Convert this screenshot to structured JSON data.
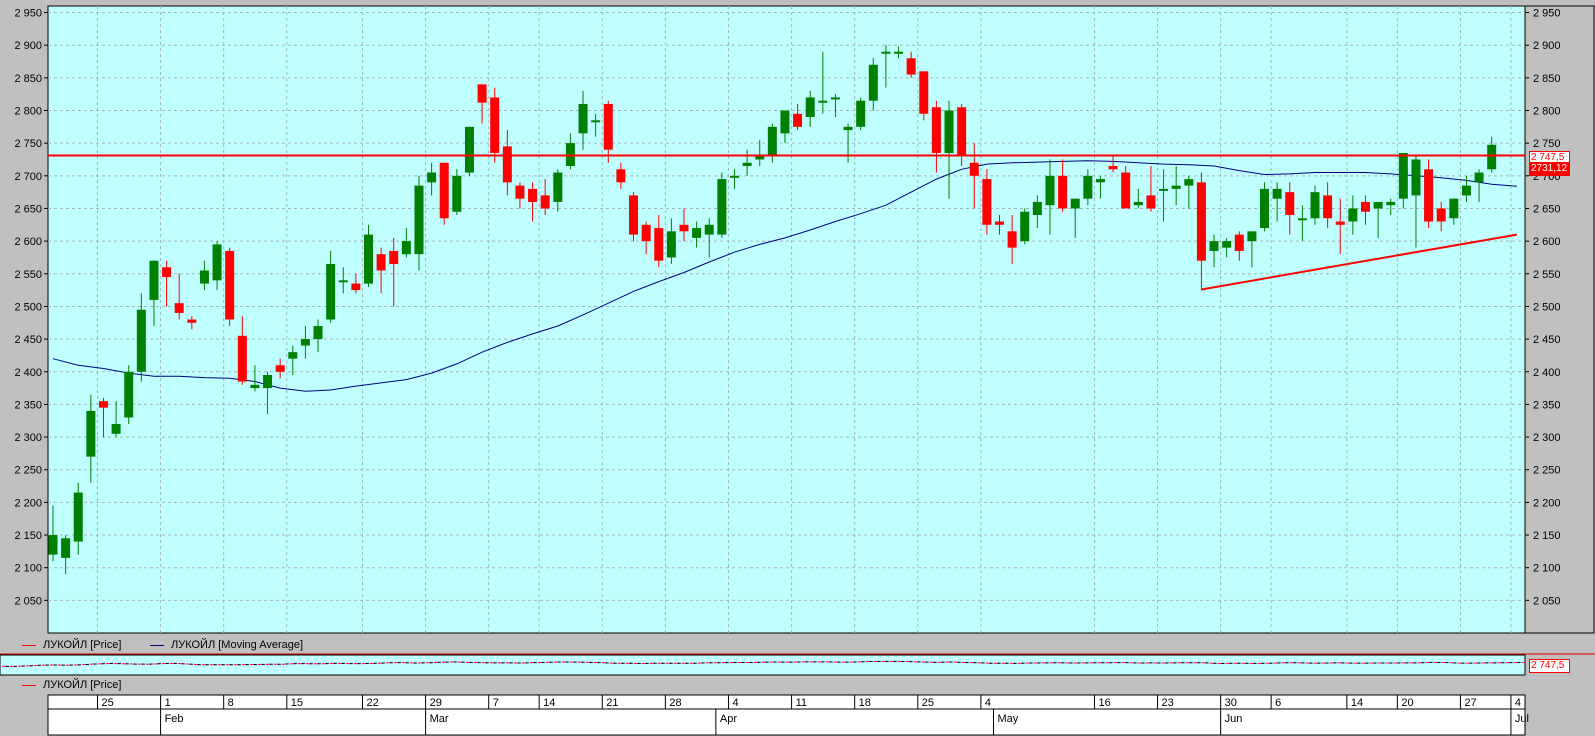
{
  "legend": {
    "price_label": "ЛУКОЙЛ [Price]",
    "ma_label": "ЛУКОЙЛ [Moving Average]"
  },
  "navigator": {
    "legend_label": "ЛУКОЙЛ [Price]"
  },
  "colors": {
    "background": "#c0ffff",
    "up": "#008000",
    "down": "#ff0000",
    "moving_average": "#000080",
    "hline": "#ff0000",
    "trendline": "#ff0000",
    "grid": "#a0b8b8"
  },
  "chart_data": {
    "type": "candlestick",
    "title": "",
    "y_range": [
      2000,
      2960
    ],
    "y_ticks": [
      2050,
      2100,
      2150,
      2200,
      2250,
      2300,
      2350,
      2400,
      2450,
      2500,
      2550,
      2600,
      2650,
      2700,
      2750,
      2800,
      2850,
      2900,
      2950
    ],
    "y_tick_labels": [
      "2 050",
      "2 100",
      "2 150",
      "2 200",
      "2 250",
      "2 300",
      "2 350",
      "2 400",
      "2 450",
      "2 500",
      "2 550",
      "2 600",
      "2 650",
      "2 700",
      "2 750",
      "2 800",
      "2 850",
      "2 900",
      "2 950"
    ],
    "x_day_labels": [
      "25",
      "1",
      "8",
      "15",
      "22",
      "29",
      "7",
      "14",
      "21",
      "28",
      "4",
      "11",
      "18",
      "25",
      "4",
      "16",
      "23",
      "30",
      "6",
      "14",
      "20",
      "27",
      "4"
    ],
    "x_month_labels": [
      "Feb",
      "Mar",
      "Apr",
      "May",
      "Jun",
      "Jul"
    ],
    "last_price_label": "2 747,5",
    "hline_label": "2731,12",
    "hline_value": 2731.12,
    "navigator_price_label": "2 747,5",
    "candles": [
      {
        "o": 2120,
        "h": 2195,
        "l": 2110,
        "c": 2150
      },
      {
        "o": 2115,
        "h": 2150,
        "l": 2090,
        "c": 2145
      },
      {
        "o": 2140,
        "h": 2230,
        "l": 2120,
        "c": 2215
      },
      {
        "o": 2270,
        "h": 2365,
        "l": 2230,
        "c": 2340
      },
      {
        "o": 2355,
        "h": 2360,
        "l": 2300,
        "c": 2345
      },
      {
        "o": 2305,
        "h": 2355,
        "l": 2300,
        "c": 2320
      },
      {
        "o": 2330,
        "h": 2410,
        "l": 2320,
        "c": 2400
      },
      {
        "o": 2400,
        "h": 2520,
        "l": 2385,
        "c": 2495
      },
      {
        "o": 2510,
        "h": 2570,
        "l": 2470,
        "c": 2570
      },
      {
        "o": 2560,
        "h": 2570,
        "l": 2500,
        "c": 2545
      },
      {
        "o": 2505,
        "h": 2550,
        "l": 2480,
        "c": 2490
      },
      {
        "o": 2480,
        "h": 2485,
        "l": 2465,
        "c": 2475
      },
      {
        "o": 2535,
        "h": 2570,
        "l": 2525,
        "c": 2555
      },
      {
        "o": 2540,
        "h": 2600,
        "l": 2525,
        "c": 2595
      },
      {
        "o": 2585,
        "h": 2590,
        "l": 2470,
        "c": 2480
      },
      {
        "o": 2455,
        "h": 2485,
        "l": 2380,
        "c": 2385
      },
      {
        "o": 2375,
        "h": 2410,
        "l": 2370,
        "c": 2380
      },
      {
        "o": 2375,
        "h": 2400,
        "l": 2335,
        "c": 2395
      },
      {
        "o": 2410,
        "h": 2420,
        "l": 2390,
        "c": 2400
      },
      {
        "o": 2420,
        "h": 2440,
        "l": 2395,
        "c": 2430
      },
      {
        "o": 2440,
        "h": 2470,
        "l": 2420,
        "c": 2450
      },
      {
        "o": 2450,
        "h": 2480,
        "l": 2430,
        "c": 2470
      },
      {
        "o": 2480,
        "h": 2585,
        "l": 2475,
        "c": 2565
      },
      {
        "o": 2540,
        "h": 2560,
        "l": 2520,
        "c": 2540
      },
      {
        "o": 2535,
        "h": 2550,
        "l": 2520,
        "c": 2525
      },
      {
        "o": 2535,
        "h": 2625,
        "l": 2530,
        "c": 2610
      },
      {
        "o": 2580,
        "h": 2590,
        "l": 2520,
        "c": 2555
      },
      {
        "o": 2585,
        "h": 2605,
        "l": 2500,
        "c": 2565
      },
      {
        "o": 2580,
        "h": 2620,
        "l": 2575,
        "c": 2600
      },
      {
        "o": 2580,
        "h": 2700,
        "l": 2555,
        "c": 2685
      },
      {
        "o": 2690,
        "h": 2720,
        "l": 2670,
        "c": 2705
      },
      {
        "o": 2720,
        "h": 2720,
        "l": 2625,
        "c": 2635
      },
      {
        "o": 2645,
        "h": 2710,
        "l": 2640,
        "c": 2700
      },
      {
        "o": 2705,
        "h": 2775,
        "l": 2700,
        "c": 2775
      },
      {
        "o": 2840,
        "h": 2840,
        "l": 2780,
        "c": 2812
      },
      {
        "o": 2820,
        "h": 2835,
        "l": 2720,
        "c": 2735
      },
      {
        "o": 2745,
        "h": 2770,
        "l": 2670,
        "c": 2690
      },
      {
        "o": 2685,
        "h": 2690,
        "l": 2650,
        "c": 2665
      },
      {
        "o": 2680,
        "h": 2690,
        "l": 2630,
        "c": 2660
      },
      {
        "o": 2670,
        "h": 2695,
        "l": 2640,
        "c": 2650
      },
      {
        "o": 2660,
        "h": 2710,
        "l": 2645,
        "c": 2705
      },
      {
        "o": 2715,
        "h": 2765,
        "l": 2710,
        "c": 2750
      },
      {
        "o": 2765,
        "h": 2830,
        "l": 2740,
        "c": 2810
      },
      {
        "o": 2785,
        "h": 2795,
        "l": 2760,
        "c": 2785
      },
      {
        "o": 2810,
        "h": 2815,
        "l": 2720,
        "c": 2740
      },
      {
        "o": 2710,
        "h": 2720,
        "l": 2680,
        "c": 2690
      },
      {
        "o": 2670,
        "h": 2675,
        "l": 2600,
        "c": 2610
      },
      {
        "o": 2625,
        "h": 2630,
        "l": 2580,
        "c": 2600
      },
      {
        "o": 2620,
        "h": 2640,
        "l": 2560,
        "c": 2570
      },
      {
        "o": 2575,
        "h": 2635,
        "l": 2565,
        "c": 2615
      },
      {
        "o": 2625,
        "h": 2650,
        "l": 2600,
        "c": 2615
      },
      {
        "o": 2605,
        "h": 2630,
        "l": 2590,
        "c": 2620
      },
      {
        "o": 2610,
        "h": 2635,
        "l": 2575,
        "c": 2625
      },
      {
        "o": 2610,
        "h": 2705,
        "l": 2605,
        "c": 2695
      },
      {
        "o": 2700,
        "h": 2710,
        "l": 2680,
        "c": 2700
      },
      {
        "o": 2715,
        "h": 2740,
        "l": 2700,
        "c": 2720
      },
      {
        "o": 2725,
        "h": 2755,
        "l": 2715,
        "c": 2730
      },
      {
        "o": 2730,
        "h": 2780,
        "l": 2720,
        "c": 2775
      },
      {
        "o": 2765,
        "h": 2800,
        "l": 2750,
        "c": 2800
      },
      {
        "o": 2795,
        "h": 2810,
        "l": 2770,
        "c": 2775
      },
      {
        "o": 2790,
        "h": 2830,
        "l": 2775,
        "c": 2820
      },
      {
        "o": 2815,
        "h": 2890,
        "l": 2795,
        "c": 2815
      },
      {
        "o": 2820,
        "h": 2825,
        "l": 2790,
        "c": 2820
      },
      {
        "o": 2770,
        "h": 2780,
        "l": 2720,
        "c": 2775
      },
      {
        "o": 2775,
        "h": 2820,
        "l": 2770,
        "c": 2815
      },
      {
        "o": 2815,
        "h": 2880,
        "l": 2800,
        "c": 2870
      },
      {
        "o": 2890,
        "h": 2900,
        "l": 2835,
        "c": 2890
      },
      {
        "o": 2888,
        "h": 2898,
        "l": 2880,
        "c": 2890
      },
      {
        "o": 2880,
        "h": 2890,
        "l": 2850,
        "c": 2855
      },
      {
        "o": 2860,
        "h": 2860,
        "l": 2785,
        "c": 2795
      },
      {
        "o": 2805,
        "h": 2815,
        "l": 2705,
        "c": 2735
      },
      {
        "o": 2735,
        "h": 2815,
        "l": 2665,
        "c": 2800
      },
      {
        "o": 2805,
        "h": 2810,
        "l": 2715,
        "c": 2730
      },
      {
        "o": 2720,
        "h": 2750,
        "l": 2650,
        "c": 2700
      },
      {
        "o": 2695,
        "h": 2710,
        "l": 2610,
        "c": 2625
      },
      {
        "o": 2630,
        "h": 2640,
        "l": 2610,
        "c": 2625
      },
      {
        "o": 2615,
        "h": 2640,
        "l": 2565,
        "c": 2590
      },
      {
        "o": 2600,
        "h": 2650,
        "l": 2595,
        "c": 2645
      },
      {
        "o": 2640,
        "h": 2670,
        "l": 2620,
        "c": 2660
      },
      {
        "o": 2655,
        "h": 2725,
        "l": 2610,
        "c": 2700
      },
      {
        "o": 2700,
        "h": 2725,
        "l": 2645,
        "c": 2650
      },
      {
        "o": 2650,
        "h": 2660,
        "l": 2605,
        "c": 2665
      },
      {
        "o": 2665,
        "h": 2710,
        "l": 2655,
        "c": 2700
      },
      {
        "o": 2690,
        "h": 2700,
        "l": 2665,
        "c": 2695
      },
      {
        "o": 2715,
        "h": 2730,
        "l": 2705,
        "c": 2710
      },
      {
        "o": 2705,
        "h": 2715,
        "l": 2650,
        "c": 2650
      },
      {
        "o": 2655,
        "h": 2680,
        "l": 2650,
        "c": 2660
      },
      {
        "o": 2670,
        "h": 2715,
        "l": 2645,
        "c": 2650
      },
      {
        "o": 2680,
        "h": 2710,
        "l": 2630,
        "c": 2680
      },
      {
        "o": 2680,
        "h": 2715,
        "l": 2655,
        "c": 2685
      },
      {
        "o": 2685,
        "h": 2700,
        "l": 2650,
        "c": 2695
      },
      {
        "o": 2690,
        "h": 2705,
        "l": 2525,
        "c": 2570
      },
      {
        "o": 2585,
        "h": 2610,
        "l": 2560,
        "c": 2600
      },
      {
        "o": 2590,
        "h": 2605,
        "l": 2575,
        "c": 2600
      },
      {
        "o": 2610,
        "h": 2615,
        "l": 2570,
        "c": 2585
      },
      {
        "o": 2600,
        "h": 2610,
        "l": 2560,
        "c": 2615
      },
      {
        "o": 2620,
        "h": 2690,
        "l": 2615,
        "c": 2680
      },
      {
        "o": 2665,
        "h": 2690,
        "l": 2630,
        "c": 2680
      },
      {
        "o": 2675,
        "h": 2690,
        "l": 2610,
        "c": 2640
      },
      {
        "o": 2635,
        "h": 2655,
        "l": 2600,
        "c": 2635
      },
      {
        "o": 2635,
        "h": 2685,
        "l": 2625,
        "c": 2675
      },
      {
        "o": 2670,
        "h": 2690,
        "l": 2620,
        "c": 2635
      },
      {
        "o": 2630,
        "h": 2665,
        "l": 2580,
        "c": 2625
      },
      {
        "o": 2630,
        "h": 2670,
        "l": 2610,
        "c": 2650
      },
      {
        "o": 2660,
        "h": 2670,
        "l": 2625,
        "c": 2645
      },
      {
        "o": 2650,
        "h": 2660,
        "l": 2605,
        "c": 2660
      },
      {
        "o": 2655,
        "h": 2665,
        "l": 2640,
        "c": 2660
      },
      {
        "o": 2665,
        "h": 2735,
        "l": 2650,
        "c": 2735
      },
      {
        "o": 2670,
        "h": 2730,
        "l": 2590,
        "c": 2725
      },
      {
        "o": 2710,
        "h": 2725,
        "l": 2620,
        "c": 2630
      },
      {
        "o": 2650,
        "h": 2660,
        "l": 2615,
        "c": 2630
      },
      {
        "o": 2635,
        "h": 2665,
        "l": 2625,
        "c": 2665
      },
      {
        "o": 2670,
        "h": 2700,
        "l": 2660,
        "c": 2685
      },
      {
        "o": 2690,
        "h": 2710,
        "l": 2660,
        "c": 2705
      },
      {
        "o": 2710,
        "h": 2760,
        "l": 2705,
        "c": 2747.5
      }
    ],
    "moving_average": [
      {
        "i": 0,
        "v": 2420
      },
      {
        "i": 2,
        "v": 2410
      },
      {
        "i": 4,
        "v": 2405
      },
      {
        "i": 6,
        "v": 2398
      },
      {
        "i": 8,
        "v": 2393
      },
      {
        "i": 10,
        "v": 2393
      },
      {
        "i": 12,
        "v": 2391
      },
      {
        "i": 14,
        "v": 2390
      },
      {
        "i": 16,
        "v": 2385
      },
      {
        "i": 18,
        "v": 2375
      },
      {
        "i": 20,
        "v": 2370
      },
      {
        "i": 22,
        "v": 2372
      },
      {
        "i": 24,
        "v": 2378
      },
      {
        "i": 26,
        "v": 2383
      },
      {
        "i": 28,
        "v": 2388
      },
      {
        "i": 30,
        "v": 2398
      },
      {
        "i": 32,
        "v": 2412
      },
      {
        "i": 34,
        "v": 2430
      },
      {
        "i": 36,
        "v": 2445
      },
      {
        "i": 38,
        "v": 2458
      },
      {
        "i": 40,
        "v": 2470
      },
      {
        "i": 42,
        "v": 2487
      },
      {
        "i": 44,
        "v": 2505
      },
      {
        "i": 46,
        "v": 2523
      },
      {
        "i": 48,
        "v": 2538
      },
      {
        "i": 50,
        "v": 2552
      },
      {
        "i": 52,
        "v": 2568
      },
      {
        "i": 54,
        "v": 2583
      },
      {
        "i": 56,
        "v": 2595
      },
      {
        "i": 58,
        "v": 2605
      },
      {
        "i": 60,
        "v": 2617
      },
      {
        "i": 62,
        "v": 2630
      },
      {
        "i": 64,
        "v": 2642
      },
      {
        "i": 66,
        "v": 2655
      },
      {
        "i": 68,
        "v": 2675
      },
      {
        "i": 70,
        "v": 2695
      },
      {
        "i": 72,
        "v": 2710
      },
      {
        "i": 74,
        "v": 2718
      },
      {
        "i": 76,
        "v": 2720
      },
      {
        "i": 78,
        "v": 2721
      },
      {
        "i": 80,
        "v": 2722
      },
      {
        "i": 82,
        "v": 2723
      },
      {
        "i": 84,
        "v": 2722
      },
      {
        "i": 86,
        "v": 2720
      },
      {
        "i": 88,
        "v": 2718
      },
      {
        "i": 90,
        "v": 2717
      },
      {
        "i": 92,
        "v": 2715
      },
      {
        "i": 94,
        "v": 2708
      },
      {
        "i": 96,
        "v": 2702
      },
      {
        "i": 98,
        "v": 2703
      },
      {
        "i": 100,
        "v": 2705
      },
      {
        "i": 102,
        "v": 2705
      },
      {
        "i": 104,
        "v": 2705
      },
      {
        "i": 106,
        "v": 2703
      },
      {
        "i": 108,
        "v": 2700
      },
      {
        "i": 110,
        "v": 2697
      },
      {
        "i": 112,
        "v": 2693
      },
      {
        "i": 114,
        "v": 2687
      },
      {
        "i": 116,
        "v": 2684
      }
    ],
    "trendline": [
      {
        "i": 91,
        "v": 2526
      },
      {
        "i": 116,
        "v": 2610
      }
    ]
  }
}
